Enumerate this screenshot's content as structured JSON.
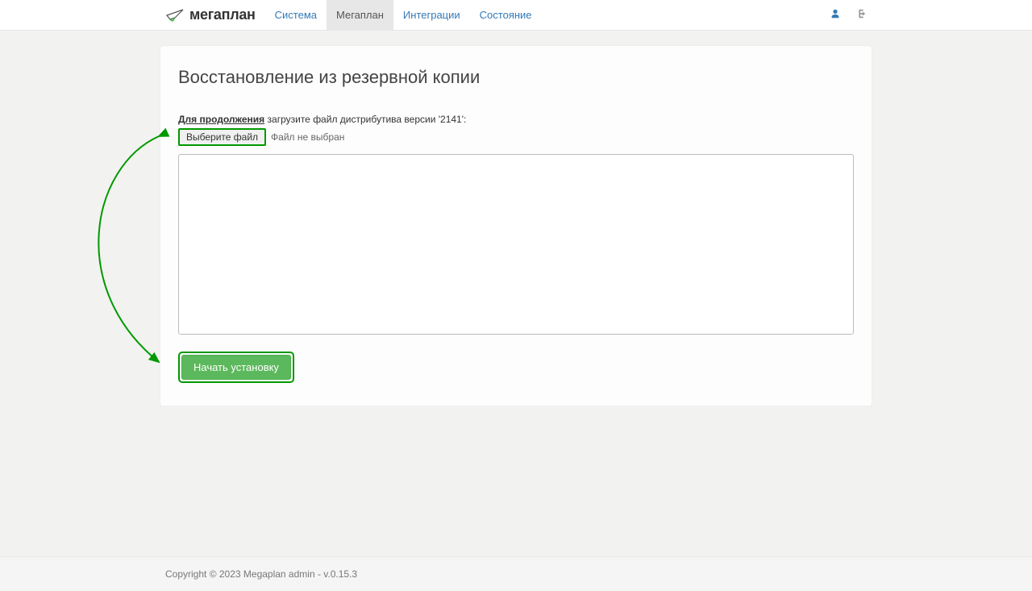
{
  "logo_text": "мегаплан",
  "nav": {
    "items": [
      {
        "label": "Система"
      },
      {
        "label": "Мегаплан"
      },
      {
        "label": "Интеграции"
      },
      {
        "label": "Состояние"
      }
    ]
  },
  "page": {
    "title": "Восстановление из резервной копии",
    "instruction_lead": "Для продолжения",
    "instruction_rest": " загрузите файл дистрибутива версии '2141':",
    "file_button_label": "Выберите файл",
    "file_status": "Файл не выбран",
    "start_button_label": "Начать установку"
  },
  "footer": {
    "text": "Copyright © 2023 Megaplan admin - v.0.15.3"
  }
}
